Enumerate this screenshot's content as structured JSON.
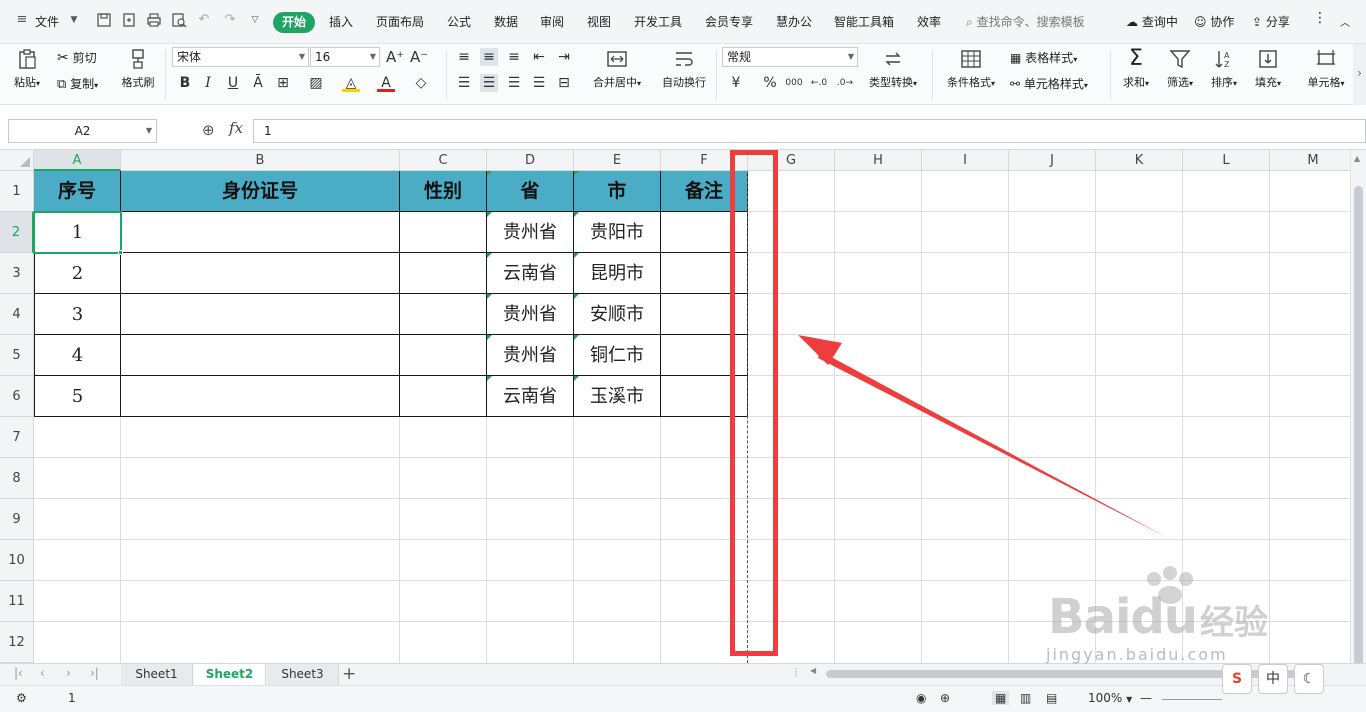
{
  "menubar": {
    "file": "文件",
    "tabs": [
      "开始",
      "插入",
      "页面布局",
      "公式",
      "数据",
      "审阅",
      "视图",
      "开发工具",
      "会员专享",
      "慧办公",
      "智能工具箱",
      "效率"
    ],
    "search": "查找命令、搜索模板",
    "right": [
      "查询中",
      "协作",
      "分享"
    ]
  },
  "ribbon": {
    "paste": "粘贴",
    "cut": "剪切",
    "copy": "复制",
    "format_painter": "格式刷",
    "font_name": "宋体",
    "font_size": "16",
    "merge_center": "合并居中",
    "wrap_text": "自动换行",
    "number_format": "常规",
    "type_convert": "类型转换",
    "conditional_format": "条件格式",
    "table_style": "表格样式",
    "cell_style": "单元格样式",
    "sum": "求和",
    "filter": "筛选",
    "sort": "排序",
    "fill": "填充",
    "cell": "单元格",
    "currency_symbol": "¥",
    "percent_symbol": "%",
    "thousands_symbol": "000"
  },
  "formula": {
    "cell_ref": "A2",
    "fx": "fx",
    "value": "1"
  },
  "grid": {
    "columns": [
      "A",
      "B",
      "C",
      "D",
      "E",
      "F",
      "G",
      "H",
      "I",
      "J",
      "K",
      "L",
      "M"
    ],
    "rows": [
      "1",
      "2",
      "3",
      "4",
      "5",
      "6",
      "7",
      "8",
      "9",
      "10",
      "11",
      "12"
    ],
    "header": [
      "序号",
      "身份证号",
      "性别",
      "省",
      "市",
      "备注"
    ],
    "data": [
      [
        "1",
        "",
        "",
        "贵州省",
        "贵阳市",
        ""
      ],
      [
        "2",
        "",
        "",
        "云南省",
        "昆明市",
        ""
      ],
      [
        "3",
        "",
        "",
        "贵州省",
        "安顺市",
        ""
      ],
      [
        "4",
        "",
        "",
        "贵州省",
        "铜仁市",
        ""
      ],
      [
        "5",
        "",
        "",
        "云南省",
        "玉溪市",
        ""
      ]
    ],
    "selected_cell": "A2",
    "header_color": "#4bacc6",
    "accent_color": "#1fa463"
  },
  "annotation": {
    "box_color": "#ee3d3d",
    "arrow_color": "#ee3d3d"
  },
  "sheets": {
    "tabs": [
      "Sheet1",
      "Sheet2",
      "Sheet3"
    ],
    "active": "Sheet2"
  },
  "status": {
    "value": "1",
    "zoom": "100%"
  },
  "watermark": {
    "brand": "Bai",
    "brand2": "du",
    "jingyan": "经验",
    "url": "jingyan.baidu.com"
  },
  "ime": {
    "mode": "中"
  }
}
